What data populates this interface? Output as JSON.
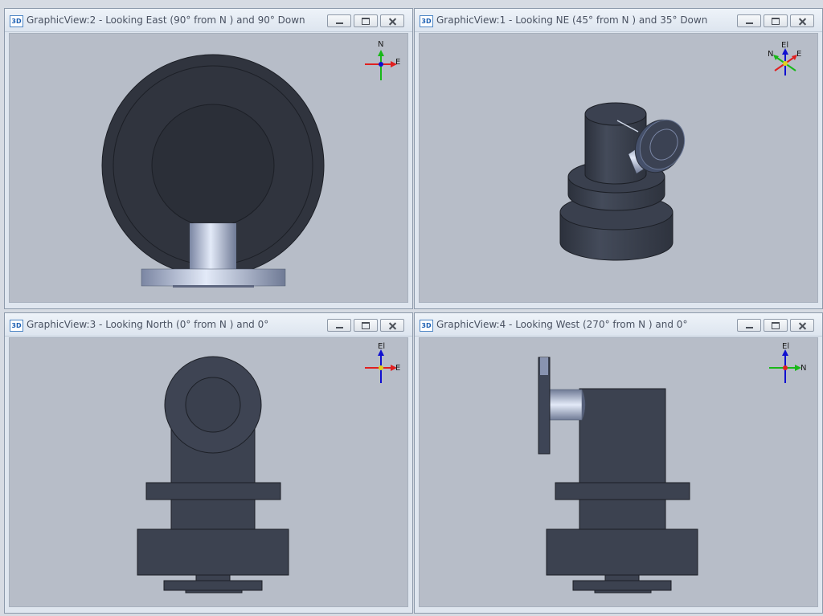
{
  "views": [
    {
      "id": "graphicview-2",
      "title": "GraphicView:2 - Looking East (90° from N ) and 90° Down",
      "app_icon": "3D",
      "axes": [
        "N",
        "E"
      ]
    },
    {
      "id": "graphicview-1",
      "title": "GraphicView:1 - Looking NE (45° from N ) and 35° Down",
      "app_icon": "3D",
      "axes": [
        "El",
        "N",
        "E"
      ]
    },
    {
      "id": "graphicview-3",
      "title": "GraphicView:3 - Looking North (0° from N ) and 0°",
      "app_icon": "3D",
      "axes": [
        "El",
        "E"
      ]
    },
    {
      "id": "graphicview-4",
      "title": "GraphicView:4 - Looking West (270° from N ) and 0°",
      "app_icon": "3D",
      "axes": [
        "El",
        "N"
      ]
    }
  ],
  "window_buttons": [
    "minimize-icon",
    "restore-icon",
    "close-icon"
  ],
  "colors": {
    "viewport_bg": "#b7bdc8",
    "model_dark": "#3c4250",
    "model_edge": "#1c1f26",
    "pipe_highlight": "#d8e2f5",
    "axis_red": "#e02020",
    "axis_green": "#18b818",
    "axis_blue": "#1010d0"
  }
}
